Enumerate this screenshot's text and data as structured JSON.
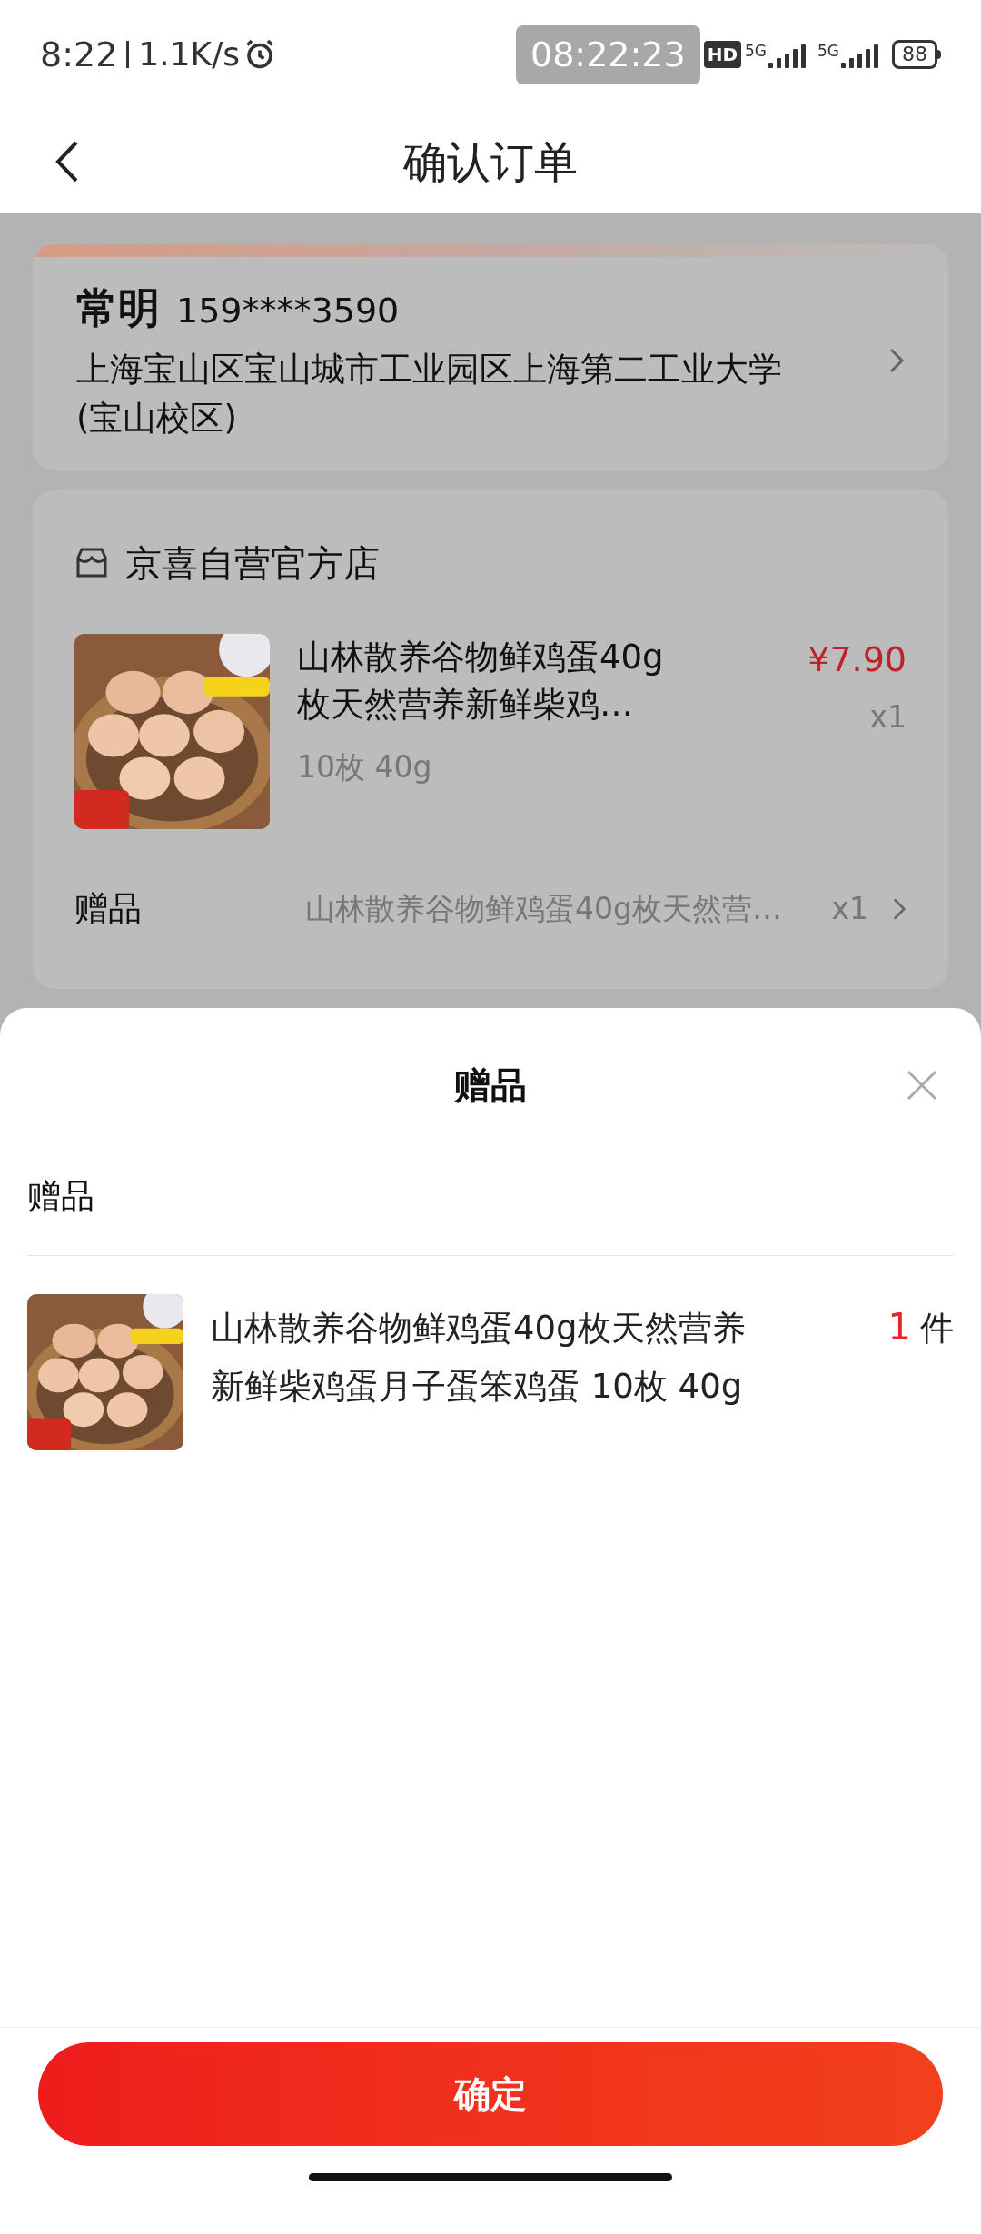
{
  "status_bar": {
    "time": "8:22",
    "speed": "1.1K/s",
    "recording_time": "08:22:23",
    "hd_badge": "HD",
    "network_1": "5G",
    "network_2": "5G",
    "battery": "88"
  },
  "header": {
    "title": "确认订单"
  },
  "address": {
    "name": "常明",
    "phone": "159****3590",
    "line": "上海宝山区宝山城市工业园区上海第二工业大学(宝山校区)"
  },
  "store": {
    "name": "京喜自营官方店",
    "product": {
      "title_lines": [
        "山林散养谷物鲜鸡蛋40g",
        "枚天然营养新鲜柴鸡…"
      ],
      "spec": "10枚 40g",
      "price": "¥7.90",
      "qty": "x1"
    },
    "gift": {
      "label": "赠品",
      "name": "山林散养谷物鲜鸡蛋40g枚天然营…",
      "qty": "x1"
    }
  },
  "sheet": {
    "title": "赠品",
    "section": "赠品",
    "items": [
      {
        "title_lines": [
          "山林散养谷物鲜鸡蛋40g枚天然营养",
          "新鲜柴鸡蛋月子蛋笨鸡蛋 10枚 40g"
        ],
        "count": "1",
        "unit": "件"
      }
    ]
  },
  "confirm_button": "确定"
}
